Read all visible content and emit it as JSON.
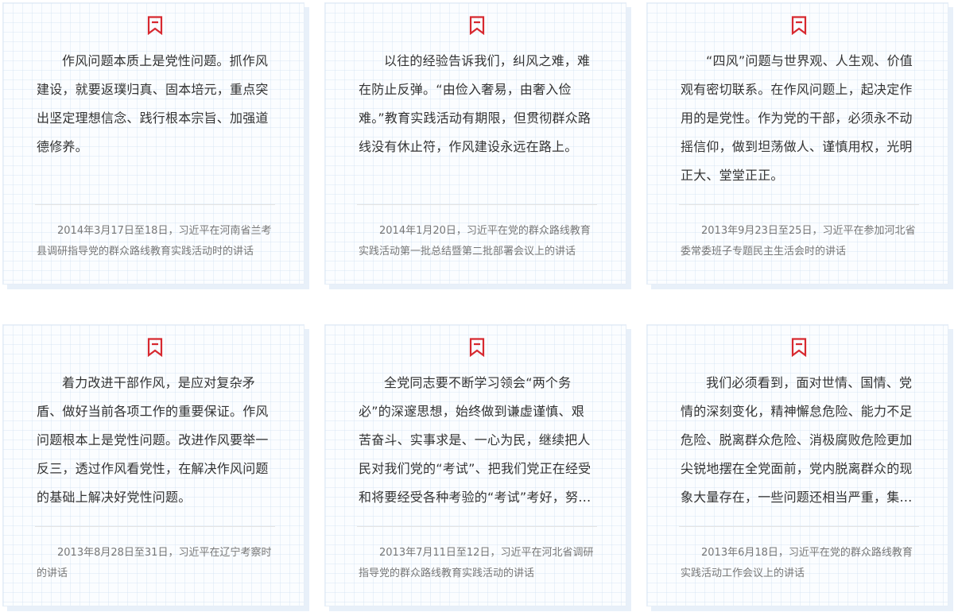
{
  "colors": {
    "bookmark_red": "#d7282f",
    "quote_text": "#333333",
    "source_text": "#777777"
  },
  "cards": [
    {
      "icon": "bookmark-icon",
      "quote": "作风问题本质上是党性问题。抓作风建设，就要返璞归真、固本培元，重点突出坚定理想信念、践行根本宗旨、加强道德修养。",
      "source": "2014年3月17日至18日，习近平在河南省兰考县调研指导党的群众路线教育实践活动时的讲话"
    },
    {
      "icon": "bookmark-icon",
      "quote": "以往的经验告诉我们，纠风之难，难在防止反弹。“由俭入奢易，由奢入俭难。”教育实践活动有期限，但贯彻群众路线没有休止符，作风建设永远在路上。",
      "source": "2014年1月20日，习近平在党的群众路线教育实践活动第一批总结暨第二批部署会议上的讲话"
    },
    {
      "icon": "bookmark-icon",
      "quote": "“四风”问题与世界观、人生观、价值观有密切联系。在作风问题上，起决定作用的是党性。作为党的干部，必须永不动摇信仰，做到坦荡做人、谨慎用权，光明正大、堂堂正正。",
      "source": "2013年9月23日至25日，习近平在参加河北省委常委班子专题民主生活会时的讲话"
    },
    {
      "icon": "bookmark-icon",
      "quote": "着力改进干部作风，是应对复杂矛盾、做好当前各项工作的重要保证。作风问题根本上是党性问题。改进作风要举一反三，透过作风看党性，在解决作风问题的基础上解决好党性问题。",
      "source": "2013年8月28日至31日，习近平在辽宁考察时的讲话"
    },
    {
      "icon": "bookmark-icon",
      "quote": "全党同志要不断学习领会“两个务必”的深邃思想，始终做到谦虚谨慎、艰苦奋斗、实事求是、一心为民，继续把人民对我们党的“考试”、把我们党正在经受和将要经受各种考验的“考试”考好，努力交出优异的答卷。",
      "source": "2013年7月11日至12日，习近平在河北省调研指导党的群众路线教育实践活动的讲话"
    },
    {
      "icon": "bookmark-icon",
      "quote": "我们必须看到，面对世情、国情、党情的深刻变化，精神懈怠危险、能力不足危险、脱离群众危险、消极腐败危险更加尖锐地摆在全党面前，党内脱离群众的现象大量存在，一些问题还相当严重，集中表现在形式主义、官僚主义、享乐主义和奢靡之风这“四风”上。",
      "source": "2013年6月18日，习近平在党的群众路线教育实践活动工作会议上的讲话"
    }
  ]
}
